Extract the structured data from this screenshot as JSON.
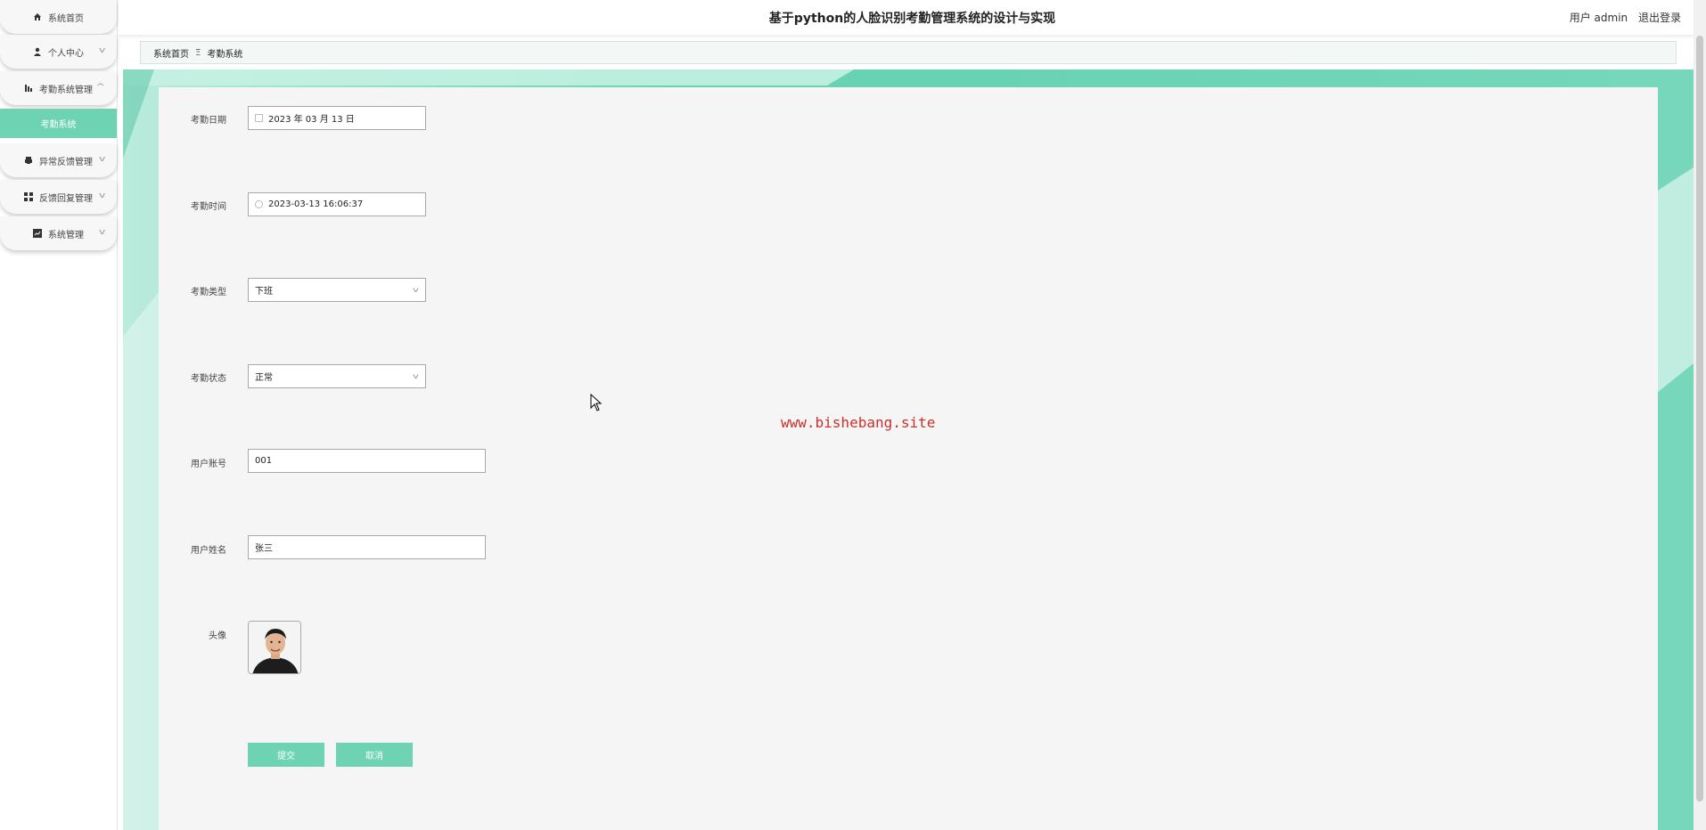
{
  "header": {
    "title": "基于python的人脸识别考勤管理系统的设计与实现",
    "user_label": "用户 admin",
    "logout_label": "退出登录"
  },
  "sidebar": {
    "items": [
      {
        "label": "系统首页",
        "icon": "home-icon"
      },
      {
        "label": "个人中心",
        "icon": "user-icon"
      },
      {
        "label": "考勤系统管理",
        "icon": "chart-icon"
      },
      {
        "label": "异常反馈管理",
        "icon": "printer-icon"
      },
      {
        "label": "反馈回复管理",
        "icon": "grid-icon"
      },
      {
        "label": "系统管理",
        "icon": "settings-icon"
      }
    ],
    "active_sub": "考勤系统"
  },
  "breadcrumb": {
    "home": "系统首页",
    "separator": "Ξ",
    "current": "考勤系统"
  },
  "form": {
    "date_label": "考勤日期",
    "date_value": "2023 年 03 月 13 日",
    "time_label": "考勤时间",
    "time_value": "2023-03-13 16:06:37",
    "type_label": "考勤类型",
    "type_value": "下班",
    "status_label": "考勤状态",
    "status_value": "正常",
    "account_label": "用户账号",
    "account_value": "001",
    "name_label": "用户姓名",
    "name_value": "张三",
    "avatar_label": "头像",
    "submit_label": "提交",
    "cancel_label": "取消"
  },
  "watermark": "www.bishebang.site",
  "colors": {
    "accent": "#6dd3b2",
    "watermark": "#c9302c"
  }
}
